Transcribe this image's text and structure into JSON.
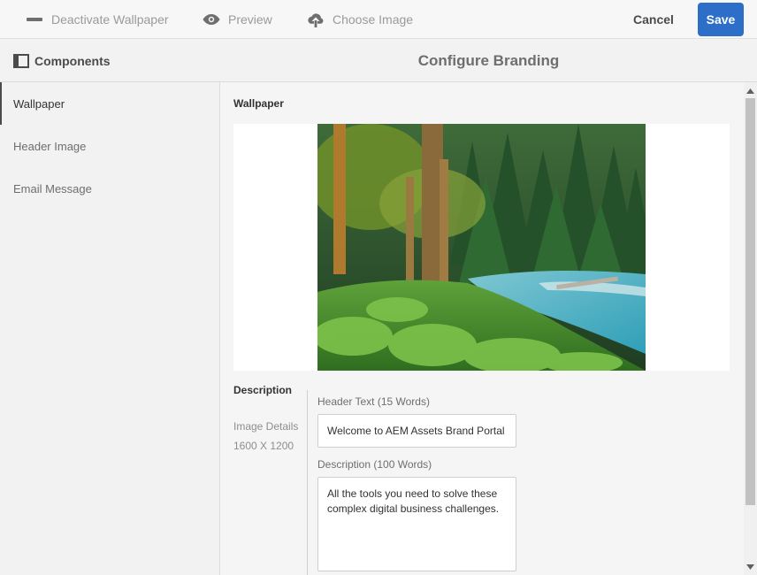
{
  "toolbar": {
    "deactivate_label": "Deactivate Wallpaper",
    "preview_label": "Preview",
    "choose_label": "Choose Image",
    "cancel_label": "Cancel",
    "save_label": "Save"
  },
  "header": {
    "components_label": "Components",
    "title": "Configure Branding"
  },
  "sidebar": {
    "items": [
      {
        "label": "Wallpaper",
        "active": true
      },
      {
        "label": "Header Image",
        "active": false
      },
      {
        "label": "Email Message",
        "active": false
      }
    ]
  },
  "main": {
    "section_title": "Wallpaper",
    "description_label": "Description",
    "image_details_label": "Image Details",
    "image_details_value": "1600 X 1200",
    "header_text_label": "Header Text (15 Words)",
    "header_text_value": "Welcome to AEM Assets Brand Portal",
    "description_field_label": "Description (100 Words)",
    "description_value": "All the tools you need to solve these complex digital business challenges."
  },
  "colors": {
    "accent": "#2d6ec9",
    "background": "#f2f2f2",
    "content_bg": "#f5f5f5"
  },
  "icons": {
    "deactivate": "minus-icon",
    "preview": "eye-icon",
    "choose": "upload-cloud-icon",
    "components": "panel-icon"
  }
}
